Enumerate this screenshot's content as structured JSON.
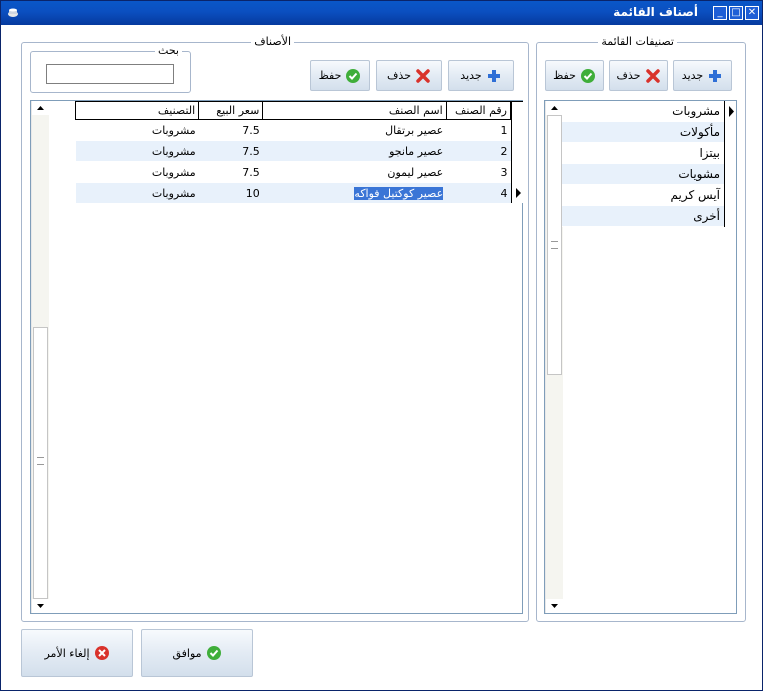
{
  "window": {
    "title": "أصناف القائمة",
    "controls": {
      "minimize": "_",
      "maximize": "□",
      "close": "✕"
    }
  },
  "categories_panel": {
    "legend": "تصنيفات القائمة",
    "buttons": {
      "new": "جديد",
      "delete": "حذف",
      "save": "حفظ"
    },
    "rows": [
      "مشروبات",
      "مأكولات",
      "بيتزا",
      "مشويات",
      "آيس كريم",
      "أخرى"
    ],
    "selected_index": 0
  },
  "items_panel": {
    "legend": "الأصناف",
    "buttons": {
      "new": "جديد",
      "delete": "حذف",
      "save": "حفظ"
    },
    "search": {
      "legend": "بحث",
      "value": ""
    },
    "columns": [
      "رقم الصنف",
      "اسم الصنف",
      "سعر البيع",
      "التصنيف"
    ],
    "rows": [
      {
        "id": "1",
        "name": "عصير برتقال",
        "price": "7.5",
        "category": "مشروبات"
      },
      {
        "id": "2",
        "name": "عصير مانجو",
        "price": "7.5",
        "category": "مشروبات"
      },
      {
        "id": "3",
        "name": "عصير ليمون",
        "price": "7.5",
        "category": "مشروبات"
      },
      {
        "id": "4",
        "name": "عصير كوكتيل فواكه",
        "price": "10",
        "category": "مشروبات"
      }
    ],
    "current_row_index": 3
  },
  "footer": {
    "ok": "موافق",
    "cancel": "إلغاء الأمر"
  },
  "colors": {
    "titlebar": "#0b4fc0",
    "row_alt": "#e8f1fb",
    "selection": "#3a75d6",
    "ok_green": "#3fae3a",
    "delete_red": "#d9322b",
    "add_blue": "#2f6fd6"
  }
}
